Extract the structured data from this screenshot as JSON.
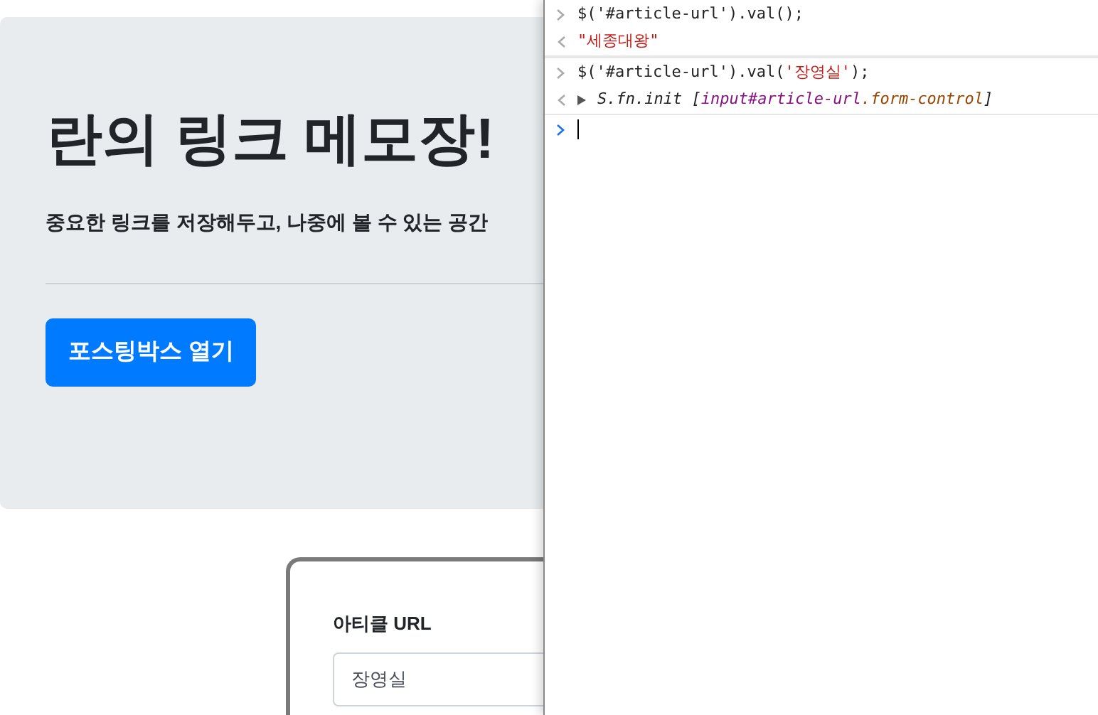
{
  "hero": {
    "title": "란의 링크 메모장!",
    "subtitle": "중요한 링크를 저장해두고, 나중에 볼 수 있는 공간",
    "button": "포스팅박스 열기"
  },
  "form": {
    "label": "아티클 URL",
    "value": "장영실"
  },
  "console": [
    {
      "kind": "input",
      "text": "$('#article-url').val();"
    },
    {
      "kind": "string",
      "text": "\"세종대왕\""
    },
    {
      "kind": "input",
      "parts": [
        {
          "kind": "code",
          "text": "$('#article-url').val("
        },
        {
          "kind": "str",
          "text": "'장영실'"
        },
        {
          "kind": "code",
          "text": ");"
        }
      ]
    },
    {
      "kind": "object",
      "parts": [
        {
          "kind": "code",
          "text": "S.fn.init ["
        },
        {
          "kind": "tag",
          "text": "input#article-url"
        },
        {
          "kind": "cls",
          "text": ".form-control"
        },
        {
          "kind": "code",
          "text": "]"
        }
      ]
    },
    {
      "kind": "prompt"
    }
  ]
}
